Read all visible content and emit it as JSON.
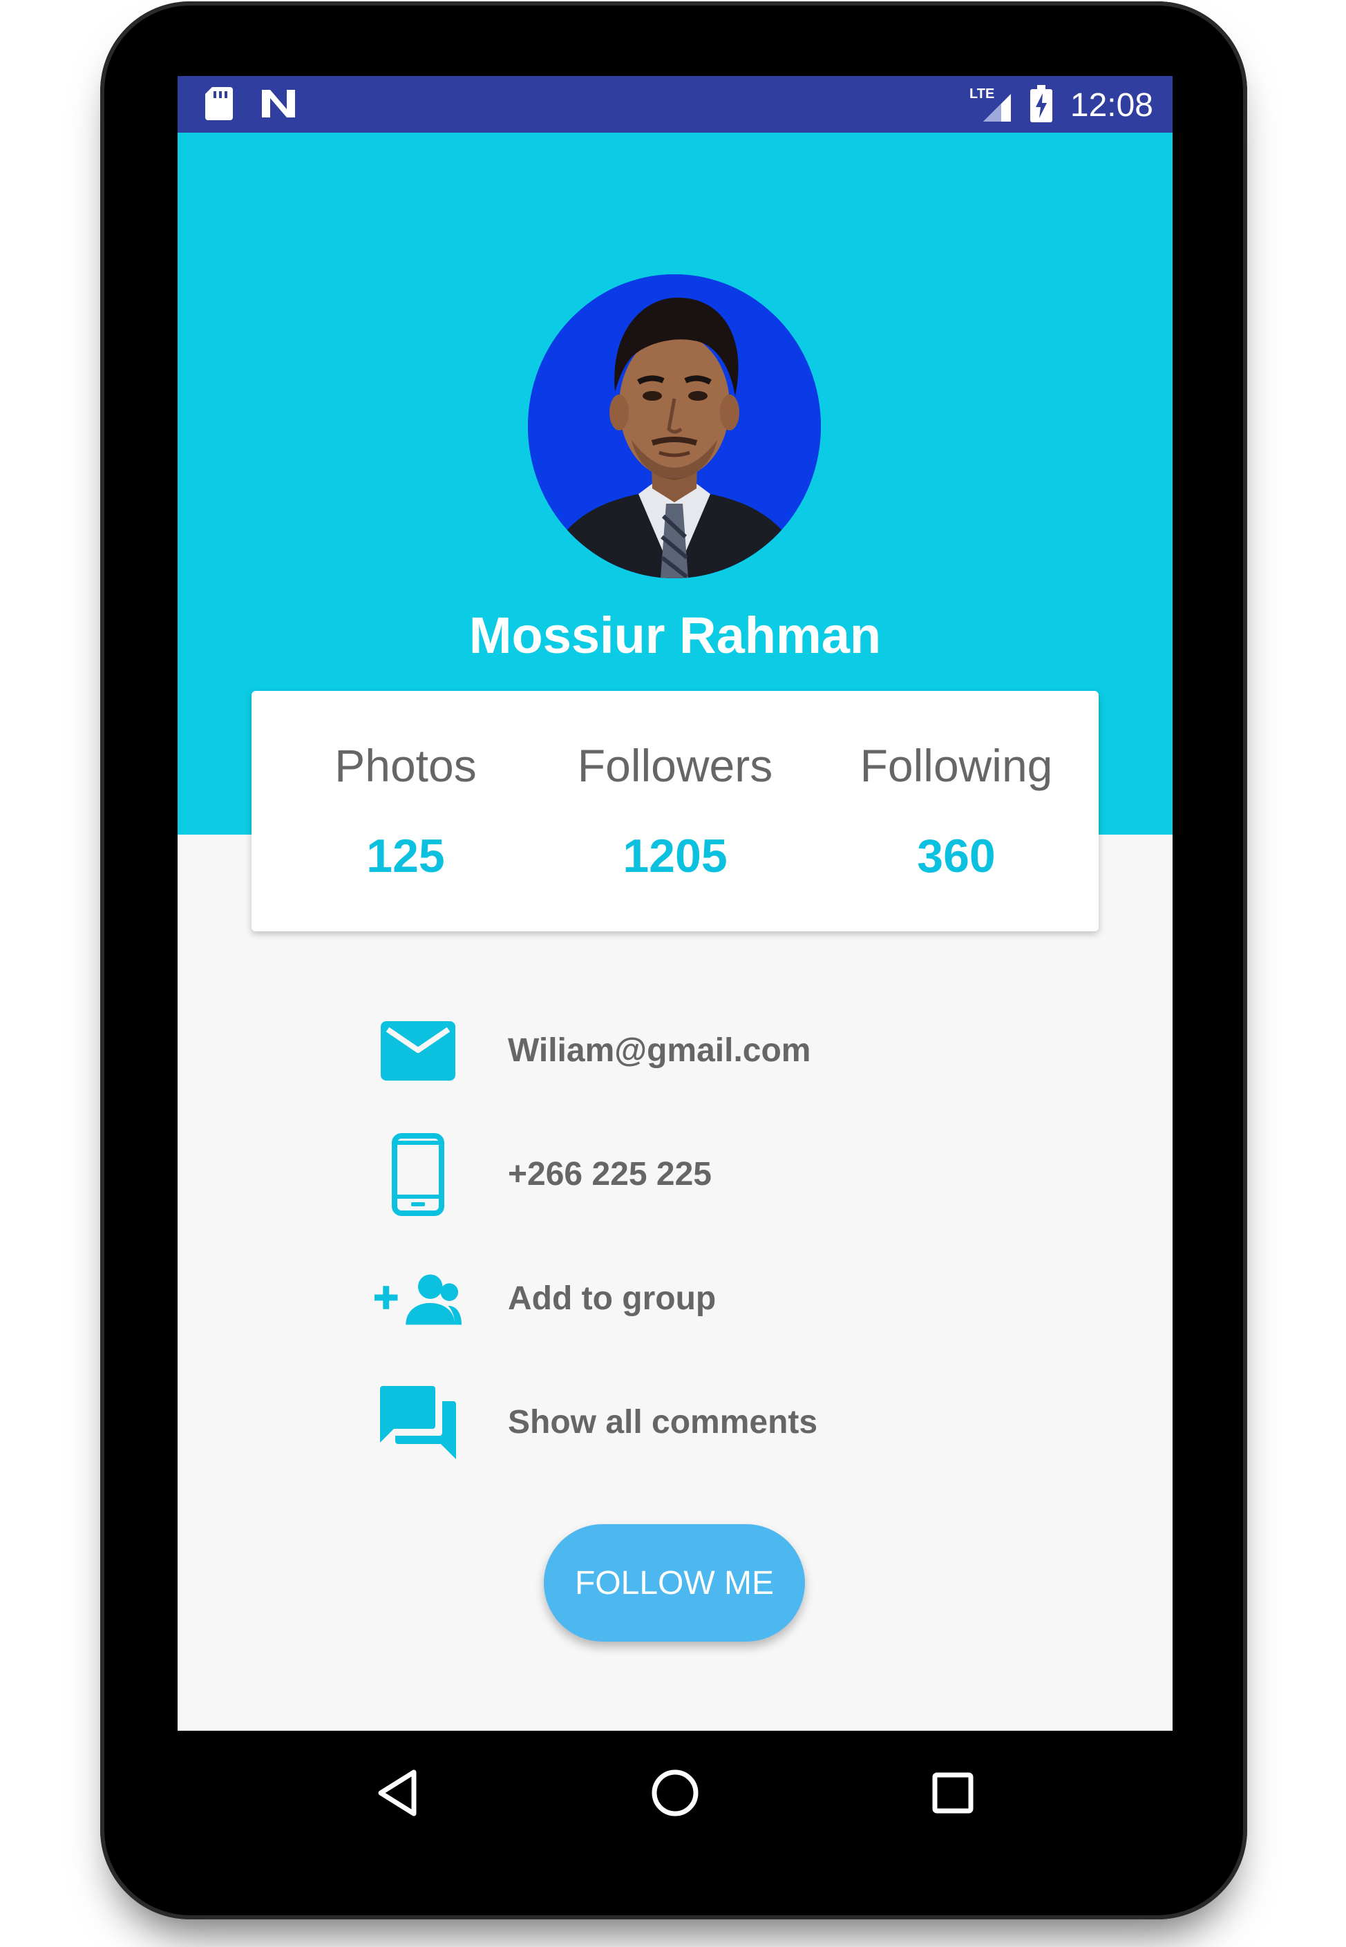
{
  "status_bar": {
    "time": "12:08",
    "network": "LTE",
    "icons": [
      "sd-card-icon",
      "n-logo-icon",
      "lte-signal-icon",
      "battery-charging-icon"
    ]
  },
  "profile": {
    "name": "Mossiur Rahman",
    "avatar": "profile-photo"
  },
  "stats": [
    {
      "label": "Photos",
      "value": "125"
    },
    {
      "label": "Followers",
      "value": "1205"
    },
    {
      "label": "Following",
      "value": "360"
    }
  ],
  "info": [
    {
      "icon": "email-icon",
      "text": "Wiliam@gmail.com"
    },
    {
      "icon": "phone-icon",
      "text": "+266 225 225"
    },
    {
      "icon": "add-group-icon",
      "text": "Add to group"
    },
    {
      "icon": "comments-icon",
      "text": "Show all comments"
    }
  ],
  "follow_button": {
    "label": "FOLLOW ME"
  },
  "nav_bar": {
    "icons": [
      "back-icon",
      "home-icon",
      "recents-icon"
    ]
  },
  "colors": {
    "status_bar": "#303f9f",
    "header": "#0ccbe4",
    "accent": "#0cc0df",
    "button": "#4db7ef",
    "avatar_bg": "#0a3be6"
  }
}
